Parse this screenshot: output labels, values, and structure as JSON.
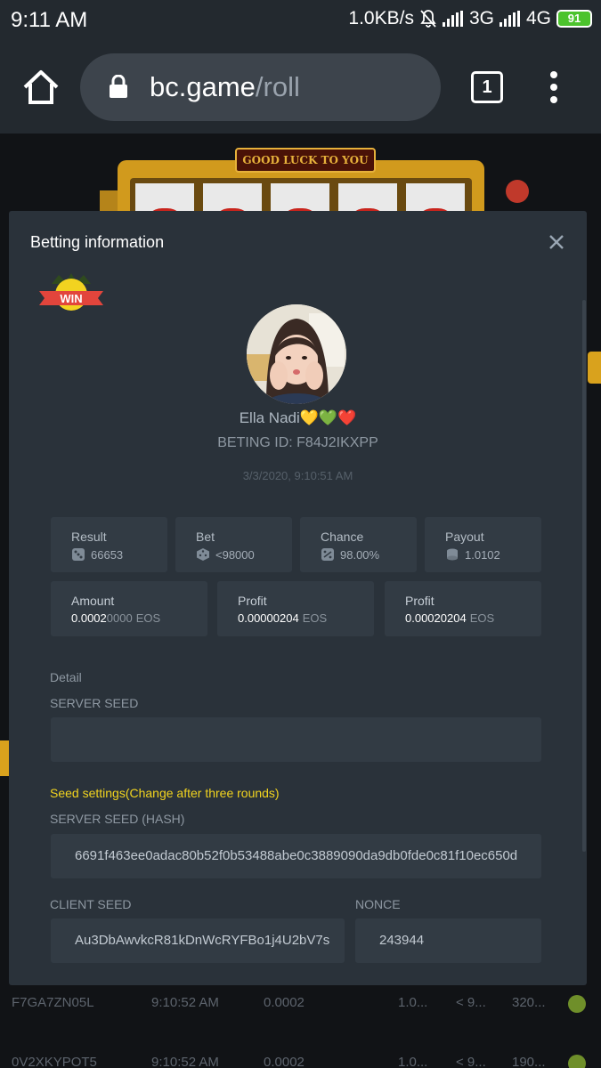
{
  "status_bar": {
    "time": "9:11 AM",
    "net_speed": "1.0KB/s",
    "net1": "3G",
    "net2": "4G",
    "battery": "91"
  },
  "browser": {
    "url_host": "bc.game",
    "url_path": "/roll",
    "tab_count": "1"
  },
  "background_page": {
    "banner": "GOOD LUCK TO YOU",
    "rows": [
      {
        "id": "F7GA7ZN05L",
        "time": "9:10:52 AM",
        "amount": "0.0002",
        "payout": "1.0...",
        "bet": "< 9...",
        "profit": "320..."
      },
      {
        "id": "0V2XKYPOT5",
        "time": "9:10:52 AM",
        "amount": "0.0002",
        "payout": "1.0...",
        "bet": "< 9...",
        "profit": "190..."
      }
    ]
  },
  "modal": {
    "title": "Betting information",
    "win_badge": "WIN",
    "user_name": "Ella Nadi",
    "user_emojis": "💛💚❤️",
    "bet_id": "BETING ID: F84J2IKXPP",
    "time": "3/3/2020, 9:10:51 AM",
    "stats": [
      {
        "label": "Result",
        "value": "66653",
        "icon": "dice-icon"
      },
      {
        "label": "Bet",
        "value": "<98000",
        "icon": "dice-cube-icon"
      },
      {
        "label": "Chance",
        "value": "98.00%",
        "icon": "chance-dice-icon"
      },
      {
        "label": "Payout",
        "value": "1.0102",
        "icon": "coin-stack-icon"
      }
    ],
    "amounts": [
      {
        "label": "Amount",
        "value_main": "0.0002",
        "value_dim": "0000",
        "unit": "EOS"
      },
      {
        "label": "Profit",
        "value_main": "0.00000204",
        "value_dim": "",
        "unit": "EOS"
      },
      {
        "label": "Profit",
        "value_main": "0.00020204",
        "value_dim": "",
        "unit": "EOS"
      }
    ],
    "detail_label": "Detail",
    "server_seed_label": "SERVER SEED",
    "server_seed_value": "",
    "seed_settings": "Seed settings(Change after three rounds)",
    "server_seed_hash_label": "SERVER SEED (HASH)",
    "server_seed_hash_value": "6691f463ee0adac80b52f0b53488abe0c3889090da9db0fde0c81f10ec650d",
    "client_seed_label": "CLIENT SEED",
    "client_seed_value": "Au3DbAwvkcR81kDnWcRYFBo1j4U2bV7s",
    "nonce_label": "NONCE",
    "nonce_value": "243944"
  },
  "colors": {
    "modal_bg": "#2a323a",
    "card_bg": "#323b44",
    "accent_yellow": "#f2d41f",
    "status_bar_bg": "#23292f"
  }
}
